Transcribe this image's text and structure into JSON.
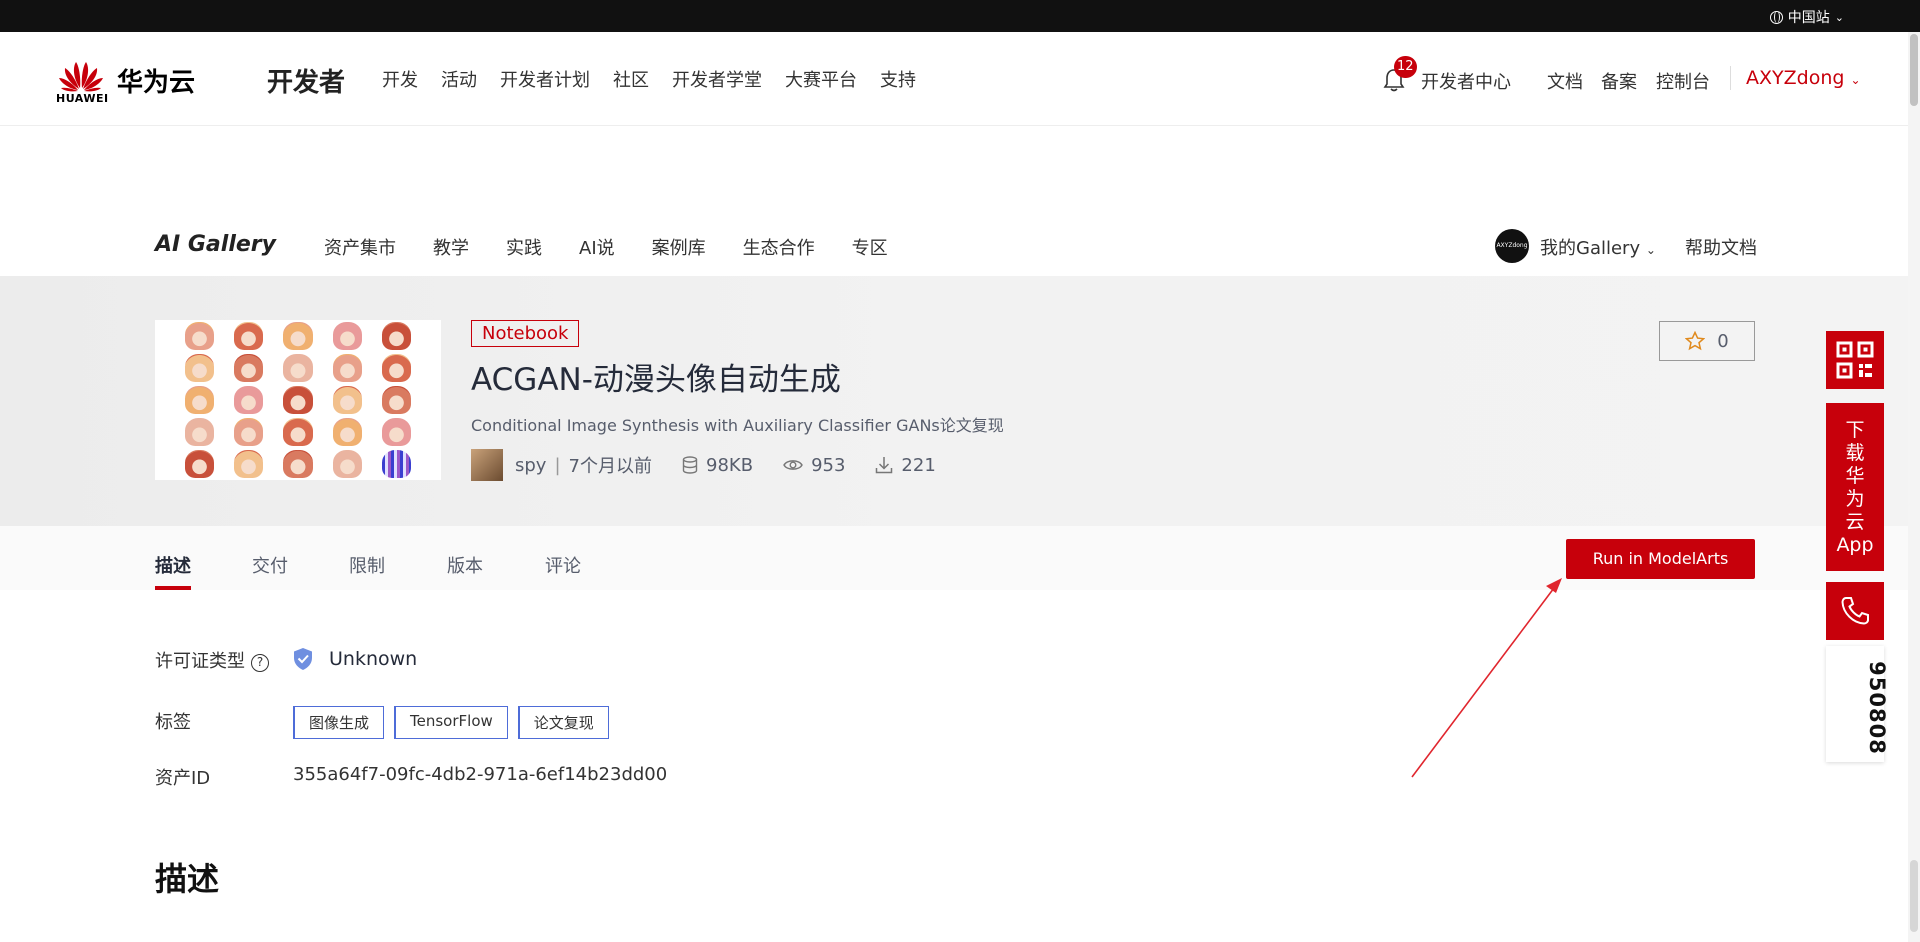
{
  "topbar": {
    "region_label": "中国站"
  },
  "header": {
    "logo_sub": "HUAWEI",
    "brand": "华为云",
    "section": "开发者",
    "nav": [
      "开发",
      "活动",
      "开发者计划",
      "社区",
      "开发者学堂",
      "大赛平台",
      "支持"
    ],
    "notification_count": "12",
    "dev_center": "开发者中心",
    "docs": "文档",
    "filing": "备案",
    "console": "控制台",
    "username": "AXYZdong"
  },
  "gallery_nav": {
    "logo": "AI Gallery",
    "items": [
      "资产集市",
      "教学",
      "实践",
      "AI说",
      "案例库",
      "生态合作",
      "专区"
    ],
    "avatar_text": "AXYZdong",
    "my_gallery": "我的Gallery",
    "help": "帮助文档"
  },
  "asset": {
    "type_tag": "Notebook",
    "title": "ACGAN-动漫头像自动生成",
    "subtitle": "Conditional Image Synthesis with Auxiliary Classifier GANs论文复现",
    "author": "spy",
    "time": "7个月以前",
    "size": "98KB",
    "views": "953",
    "downloads": "221",
    "stars": "0"
  },
  "tabs": {
    "items": [
      "描述",
      "交付",
      "限制",
      "版本",
      "评论"
    ],
    "active": "描述",
    "run_button": "Run in ModelArts"
  },
  "details": {
    "license_label": "许可证类型",
    "license_value": "Unknown",
    "tags_label": "标签",
    "tags": [
      "图像生成",
      "TensorFlow",
      "论文复现"
    ],
    "asset_id_label": "资产ID",
    "asset_id": "355a64f7-09fc-4db2-971a-6ef14b23dd00",
    "section_heading": "描述"
  },
  "float_panel": {
    "app_label": "下载华为云App",
    "app_chars": [
      "下",
      "载",
      "华",
      "为",
      "云",
      "App"
    ],
    "hotline": "950808"
  },
  "colors": {
    "brand_red": "#c7000b",
    "tag_blue": "#4e6cd8",
    "annotation_red": "#e0262e"
  }
}
